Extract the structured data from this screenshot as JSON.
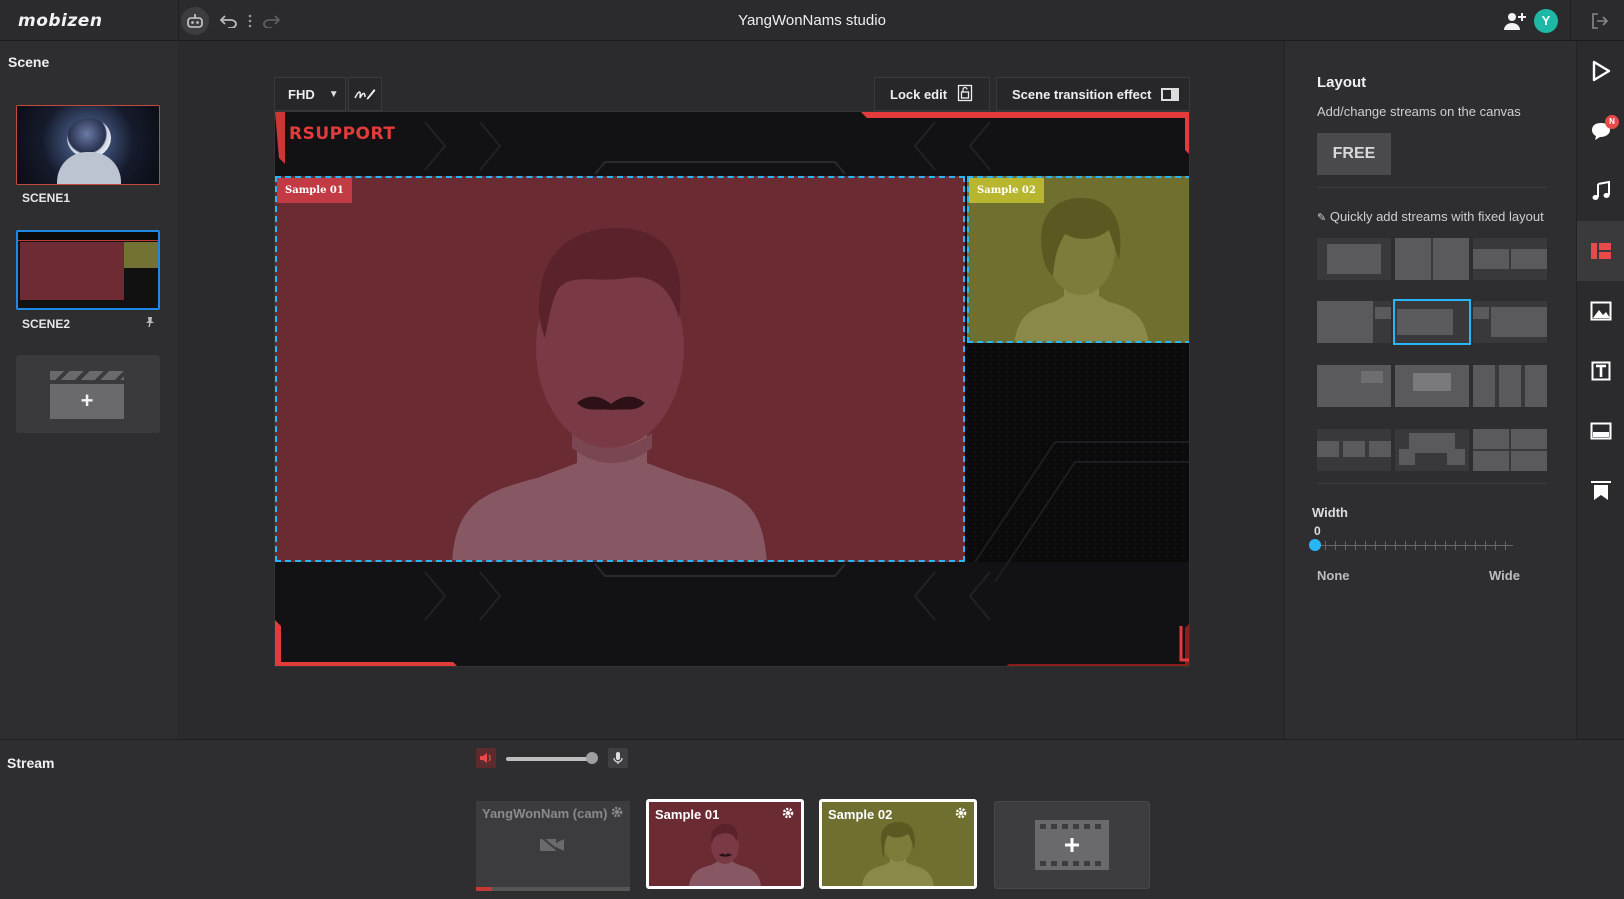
{
  "app": {
    "logo": "mobizen",
    "title": "YangWonNams studio",
    "avatar_initial": "Y",
    "accent": "#29b6f6",
    "brand_red": "#e23b3b"
  },
  "scene_panel": {
    "title": "Scene",
    "scenes": [
      {
        "label": "SCENE1"
      },
      {
        "label": "SCENE2",
        "pinned": true,
        "selected": true
      }
    ],
    "add_scene_icon": "plus-icon"
  },
  "canvas": {
    "resolution": "FHD",
    "lock_edit_label": "Lock edit",
    "transition_label": "Scene transition effect",
    "brand_text": "RSUPPORT",
    "streams": [
      {
        "tag": "Sample 01",
        "color": "#6a2b33"
      },
      {
        "tag": "Sample 02",
        "color": "#6f6f2f"
      }
    ]
  },
  "layout_panel": {
    "title": "Layout",
    "subtitle": "Add/change streams on the canvas",
    "free_label": "FREE",
    "quick_label": "Quickly add streams with fixed layout",
    "selected_preset": 4,
    "width": {
      "label": "Width",
      "value": "0",
      "min_label": "None",
      "max_label": "Wide"
    }
  },
  "icon_strip": {
    "items": [
      "play-icon",
      "chat-icon",
      "music-icon",
      "layout-icon",
      "image-icon",
      "text-icon",
      "caption-icon",
      "bookmark-icon"
    ],
    "chat_badge": "N"
  },
  "stream_panel": {
    "title": "Stream",
    "cards": [
      {
        "title": "YangWonNam (cam)"
      },
      {
        "title": "Sample 01"
      },
      {
        "title": "Sample 02"
      }
    ]
  }
}
